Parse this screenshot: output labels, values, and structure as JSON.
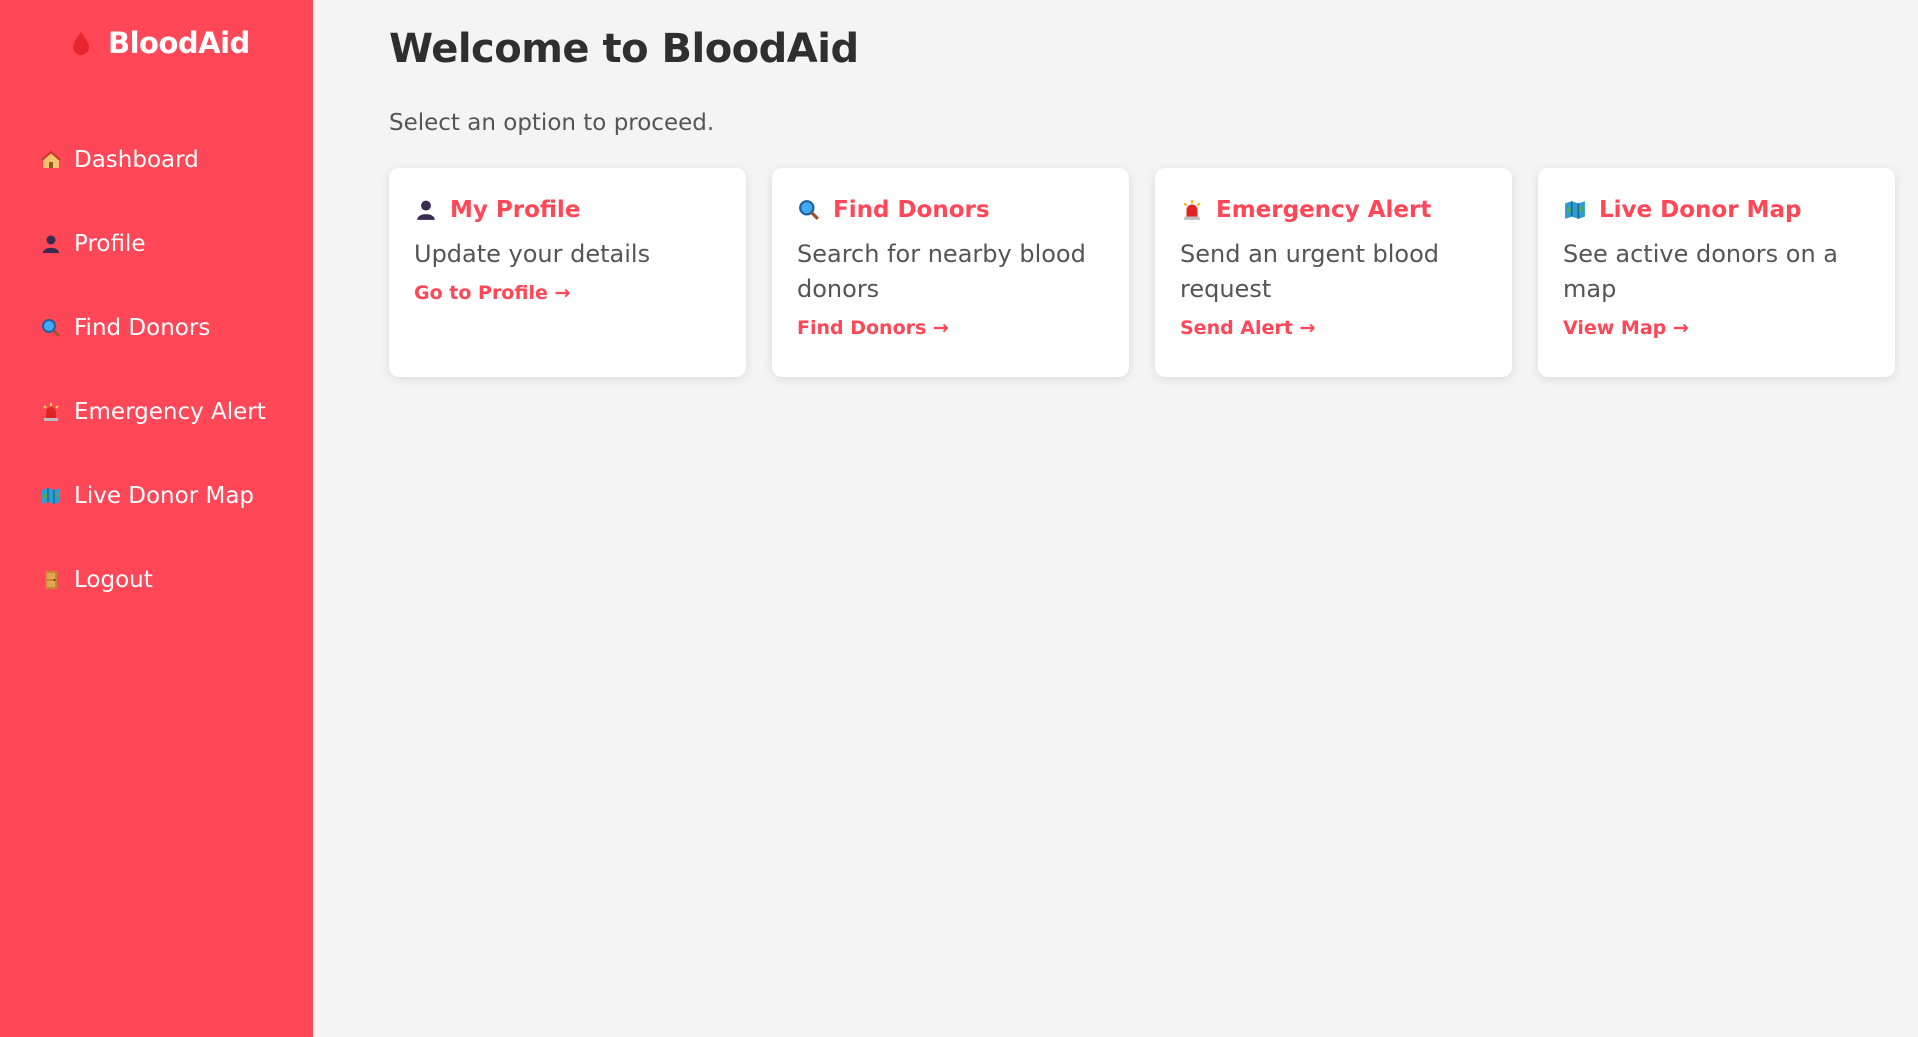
{
  "sidebar": {
    "brand": "BloodAid",
    "brand_icon": "blood-drop-icon",
    "items": [
      {
        "label": "Dashboard",
        "icon": "house-icon"
      },
      {
        "label": "Profile",
        "icon": "person-icon"
      },
      {
        "label": "Find Donors",
        "icon": "magnifier-icon"
      },
      {
        "label": "Emergency Alert",
        "icon": "siren-icon"
      },
      {
        "label": "Live Donor Map",
        "icon": "map-icon"
      },
      {
        "label": "Logout",
        "icon": "door-icon"
      }
    ]
  },
  "main": {
    "title": "Welcome to BloodAid",
    "subtitle": "Select an option to proceed.",
    "cards": [
      {
        "title": "My Profile",
        "icon": "person-icon",
        "description": "Update your details",
        "link": "Go to Profile →"
      },
      {
        "title": "Find Donors",
        "icon": "magnifier-icon",
        "description": "Search for nearby blood donors",
        "link": "Find Donors →"
      },
      {
        "title": "Emergency Alert",
        "icon": "siren-icon",
        "description": "Send an urgent blood request",
        "link": "Send Alert →"
      },
      {
        "title": "Live Donor Map",
        "icon": "map-icon",
        "description": "See active donors on a map",
        "link": "View Map →"
      }
    ]
  },
  "colors": {
    "accent": "#ff4757",
    "background": "#f4f4f4",
    "card": "#ffffff",
    "heading": "#2f2f2f",
    "text": "#555555"
  }
}
